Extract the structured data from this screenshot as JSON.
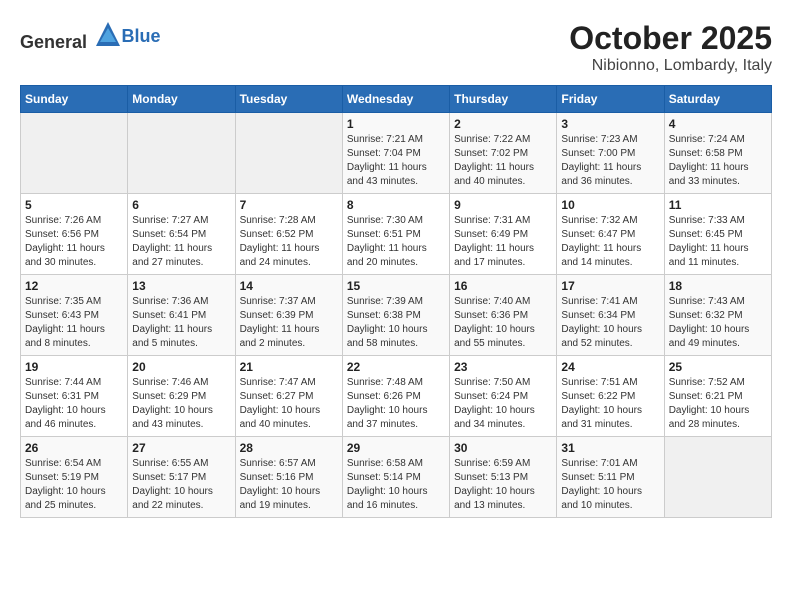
{
  "logo": {
    "text_general": "General",
    "text_blue": "Blue"
  },
  "title": {
    "month": "October 2025",
    "location": "Nibionno, Lombardy, Italy"
  },
  "days_of_week": [
    "Sunday",
    "Monday",
    "Tuesday",
    "Wednesday",
    "Thursday",
    "Friday",
    "Saturday"
  ],
  "weeks": [
    [
      {
        "day": "",
        "info": ""
      },
      {
        "day": "",
        "info": ""
      },
      {
        "day": "",
        "info": ""
      },
      {
        "day": "1",
        "info": "Sunrise: 7:21 AM\nSunset: 7:04 PM\nDaylight: 11 hours and 43 minutes."
      },
      {
        "day": "2",
        "info": "Sunrise: 7:22 AM\nSunset: 7:02 PM\nDaylight: 11 hours and 40 minutes."
      },
      {
        "day": "3",
        "info": "Sunrise: 7:23 AM\nSunset: 7:00 PM\nDaylight: 11 hours and 36 minutes."
      },
      {
        "day": "4",
        "info": "Sunrise: 7:24 AM\nSunset: 6:58 PM\nDaylight: 11 hours and 33 minutes."
      }
    ],
    [
      {
        "day": "5",
        "info": "Sunrise: 7:26 AM\nSunset: 6:56 PM\nDaylight: 11 hours and 30 minutes."
      },
      {
        "day": "6",
        "info": "Sunrise: 7:27 AM\nSunset: 6:54 PM\nDaylight: 11 hours and 27 minutes."
      },
      {
        "day": "7",
        "info": "Sunrise: 7:28 AM\nSunset: 6:52 PM\nDaylight: 11 hours and 24 minutes."
      },
      {
        "day": "8",
        "info": "Sunrise: 7:30 AM\nSunset: 6:51 PM\nDaylight: 11 hours and 20 minutes."
      },
      {
        "day": "9",
        "info": "Sunrise: 7:31 AM\nSunset: 6:49 PM\nDaylight: 11 hours and 17 minutes."
      },
      {
        "day": "10",
        "info": "Sunrise: 7:32 AM\nSunset: 6:47 PM\nDaylight: 11 hours and 14 minutes."
      },
      {
        "day": "11",
        "info": "Sunrise: 7:33 AM\nSunset: 6:45 PM\nDaylight: 11 hours and 11 minutes."
      }
    ],
    [
      {
        "day": "12",
        "info": "Sunrise: 7:35 AM\nSunset: 6:43 PM\nDaylight: 11 hours and 8 minutes."
      },
      {
        "day": "13",
        "info": "Sunrise: 7:36 AM\nSunset: 6:41 PM\nDaylight: 11 hours and 5 minutes."
      },
      {
        "day": "14",
        "info": "Sunrise: 7:37 AM\nSunset: 6:39 PM\nDaylight: 11 hours and 2 minutes."
      },
      {
        "day": "15",
        "info": "Sunrise: 7:39 AM\nSunset: 6:38 PM\nDaylight: 10 hours and 58 minutes."
      },
      {
        "day": "16",
        "info": "Sunrise: 7:40 AM\nSunset: 6:36 PM\nDaylight: 10 hours and 55 minutes."
      },
      {
        "day": "17",
        "info": "Sunrise: 7:41 AM\nSunset: 6:34 PM\nDaylight: 10 hours and 52 minutes."
      },
      {
        "day": "18",
        "info": "Sunrise: 7:43 AM\nSunset: 6:32 PM\nDaylight: 10 hours and 49 minutes."
      }
    ],
    [
      {
        "day": "19",
        "info": "Sunrise: 7:44 AM\nSunset: 6:31 PM\nDaylight: 10 hours and 46 minutes."
      },
      {
        "day": "20",
        "info": "Sunrise: 7:46 AM\nSunset: 6:29 PM\nDaylight: 10 hours and 43 minutes."
      },
      {
        "day": "21",
        "info": "Sunrise: 7:47 AM\nSunset: 6:27 PM\nDaylight: 10 hours and 40 minutes."
      },
      {
        "day": "22",
        "info": "Sunrise: 7:48 AM\nSunset: 6:26 PM\nDaylight: 10 hours and 37 minutes."
      },
      {
        "day": "23",
        "info": "Sunrise: 7:50 AM\nSunset: 6:24 PM\nDaylight: 10 hours and 34 minutes."
      },
      {
        "day": "24",
        "info": "Sunrise: 7:51 AM\nSunset: 6:22 PM\nDaylight: 10 hours and 31 minutes."
      },
      {
        "day": "25",
        "info": "Sunrise: 7:52 AM\nSunset: 6:21 PM\nDaylight: 10 hours and 28 minutes."
      }
    ],
    [
      {
        "day": "26",
        "info": "Sunrise: 6:54 AM\nSunset: 5:19 PM\nDaylight: 10 hours and 25 minutes."
      },
      {
        "day": "27",
        "info": "Sunrise: 6:55 AM\nSunset: 5:17 PM\nDaylight: 10 hours and 22 minutes."
      },
      {
        "day": "28",
        "info": "Sunrise: 6:57 AM\nSunset: 5:16 PM\nDaylight: 10 hours and 19 minutes."
      },
      {
        "day": "29",
        "info": "Sunrise: 6:58 AM\nSunset: 5:14 PM\nDaylight: 10 hours and 16 minutes."
      },
      {
        "day": "30",
        "info": "Sunrise: 6:59 AM\nSunset: 5:13 PM\nDaylight: 10 hours and 13 minutes."
      },
      {
        "day": "31",
        "info": "Sunrise: 7:01 AM\nSunset: 5:11 PM\nDaylight: 10 hours and 10 minutes."
      },
      {
        "day": "",
        "info": ""
      }
    ]
  ]
}
